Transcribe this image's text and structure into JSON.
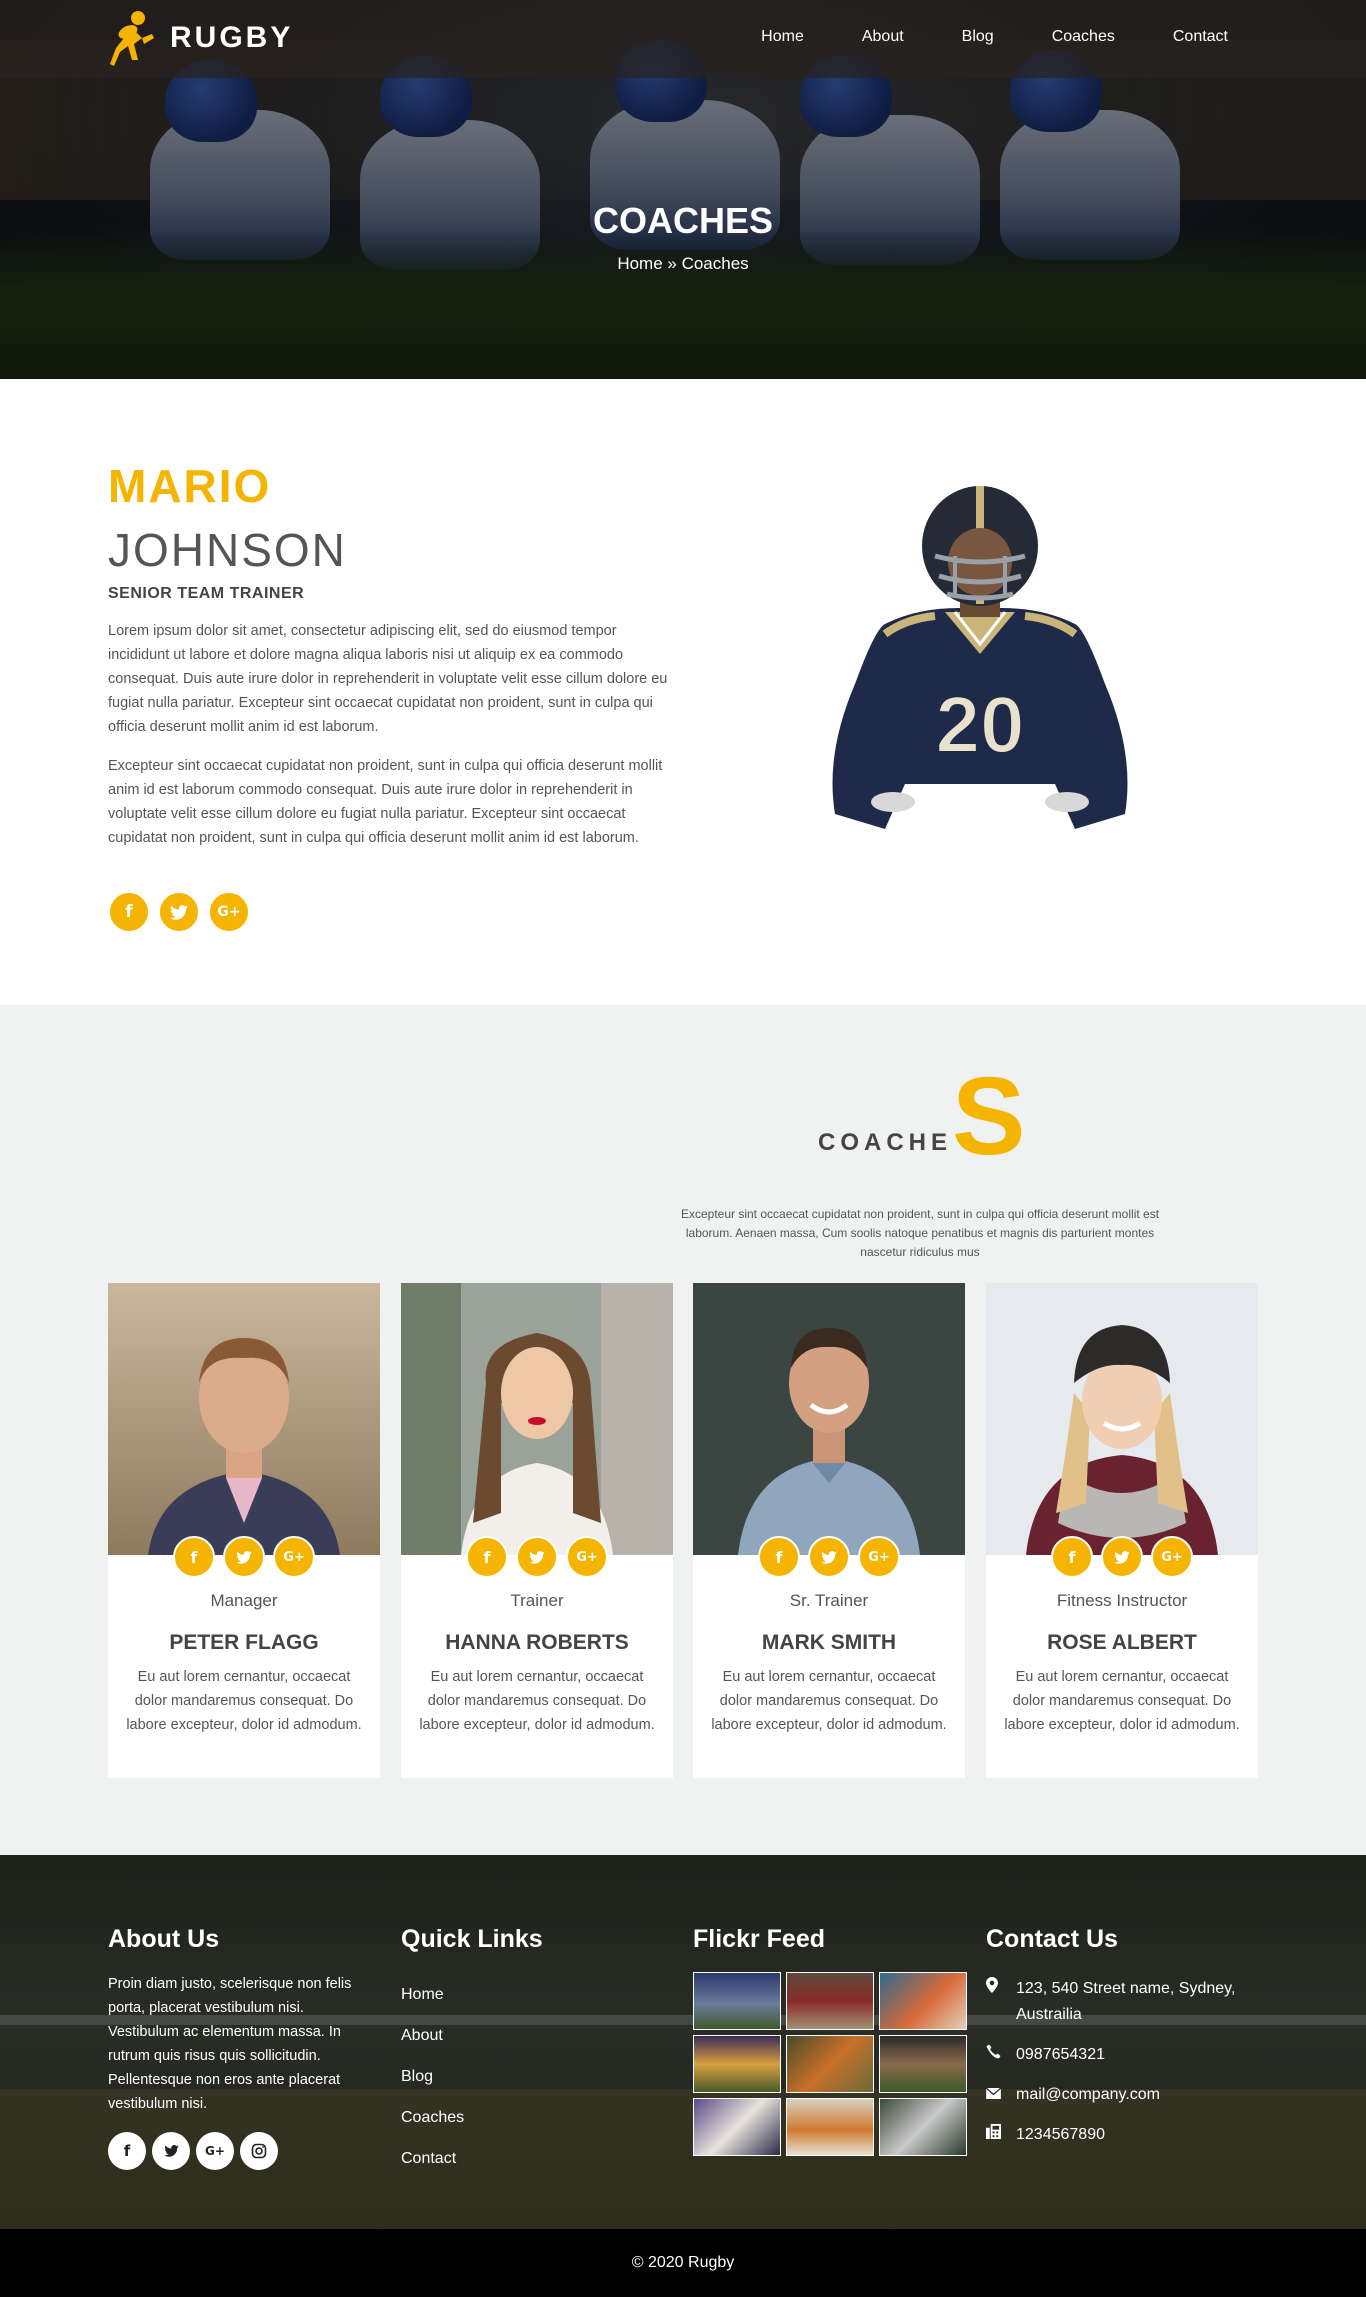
{
  "brand": {
    "name": "RUGBY",
    "accent": "#f4b400"
  },
  "nav": {
    "items": [
      {
        "label": "Home"
      },
      {
        "label": "About"
      },
      {
        "label": "Blog"
      },
      {
        "label": "Coaches"
      },
      {
        "label": "Contact"
      }
    ]
  },
  "hero": {
    "title": "COACHES",
    "breadcrumb": "Home » Coaches"
  },
  "profile": {
    "first_name": "MARIO",
    "last_name": "JOHNSON",
    "role": "SENIOR TEAM TRAINER",
    "paragraph1": "Lorem ipsum dolor sit amet, consectetur adipiscing elit, sed do eiusmod tempor incididunt ut labore et dolore magna aliqua laboris nisi ut aliquip ex ea commodo consequat. Duis aute irure dolor in reprehenderit in voluptate velit esse cillum dolore eu fugiat nulla pariatur. Excepteur sint occaecat cupidatat non proident, sunt in culpa qui officia deserunt mollit anim id est laborum.",
    "paragraph2": "Excepteur sint occaecat cupidatat non proident, sunt in culpa qui officia deserunt mollit anim id est laborum commodo consequat. Duis aute irure dolor in reprehenderit in voluptate velit esse cillum dolore eu fugiat nulla pariatur. Excepteur sint occaecat cupidatat non proident, sunt in culpa qui officia deserunt mollit anim id est laborum.",
    "jersey_number": "20",
    "social": [
      {
        "icon": "facebook-icon",
        "glyph": "f"
      },
      {
        "icon": "twitter-icon",
        "glyph": "t"
      },
      {
        "icon": "google-plus-icon",
        "glyph": "G+"
      }
    ]
  },
  "coaches_section": {
    "title_small": "COACHE",
    "title_big": "S",
    "description": "Excepteur sint occaecat cupidatat non proident, sunt in culpa qui officia deserunt mollit est laborum. Aenaen massa, Cum soolis natoque penatibus et magnis dis parturient montes nascetur ridiculus mus",
    "cards": [
      {
        "role": "Manager",
        "name": "PETER FLAGG",
        "text": "Eu aut lorem cernantur, occaecat dolor mandaremus consequat. Do labore excepteur, dolor id admodum."
      },
      {
        "role": "Trainer",
        "name": "HANNA ROBERTS",
        "text": "Eu aut lorem cernantur, occaecat dolor mandaremus consequat. Do labore excepteur, dolor id admodum."
      },
      {
        "role": "Sr. Trainer",
        "name": "MARK SMITH",
        "text": "Eu aut lorem cernantur, occaecat dolor mandaremus consequat. Do labore excepteur, dolor id admodum."
      },
      {
        "role": "Fitness Instructor",
        "name": "ROSE ALBERT",
        "text": "Eu aut lorem cernantur, occaecat dolor mandaremus consequat. Do labore excepteur, dolor id admodum."
      }
    ]
  },
  "footer": {
    "about": {
      "heading": "About Us",
      "text": "Proin diam justo, scelerisque non felis porta, placerat vestibulum nisi. Vestibulum ac elementum massa. In rutrum quis risus quis sollicitudin. Pellentesque non eros ante placerat vestibulum nisi."
    },
    "quick_links": {
      "heading": "Quick Links",
      "items": [
        "Home",
        "About",
        "Blog",
        "Coaches",
        "Contact"
      ]
    },
    "flickr": {
      "heading": "Flickr Feed"
    },
    "contact": {
      "heading": "Contact Us",
      "address": "123, 540 Street name, Sydney, Austrailia",
      "phone": "0987654321",
      "email": "mail@company.com",
      "fax": "1234567890"
    },
    "copyright": "© 2020 Rugby"
  }
}
